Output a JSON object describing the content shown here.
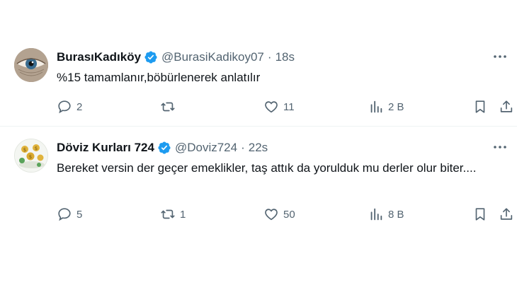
{
  "tweets": [
    {
      "name": "BurasıKadıköy",
      "handle": "@BurasiKadikoy07",
      "separator": "·",
      "time": "18s",
      "text": "%15 tamamlanır,böbürlenerek anlatılır",
      "replies": "2",
      "retweets": "",
      "likes": "11",
      "views": "2 B"
    },
    {
      "name": "Döviz Kurları 724",
      "handle": "@Doviz724",
      "separator": "·",
      "time": "22s",
      "text": "Bereket versin der geçer emeklikler, taş attık da yorulduk mu derler olur biter....",
      "replies": "5",
      "retweets": "1",
      "likes": "50",
      "views": "8 B"
    }
  ],
  "colors": {
    "verified": "#1d9bf0",
    "muted": "#536471",
    "text": "#0f1419"
  },
  "icons": {
    "reply": "speech-bubble-icon",
    "retweet": "retweet-arrows-icon",
    "like": "heart-icon",
    "views": "bar-chart-icon",
    "bookmark": "bookmark-icon",
    "share": "share-upload-icon",
    "more": "ellipsis-icon",
    "verified": "verified-badge-icon"
  }
}
